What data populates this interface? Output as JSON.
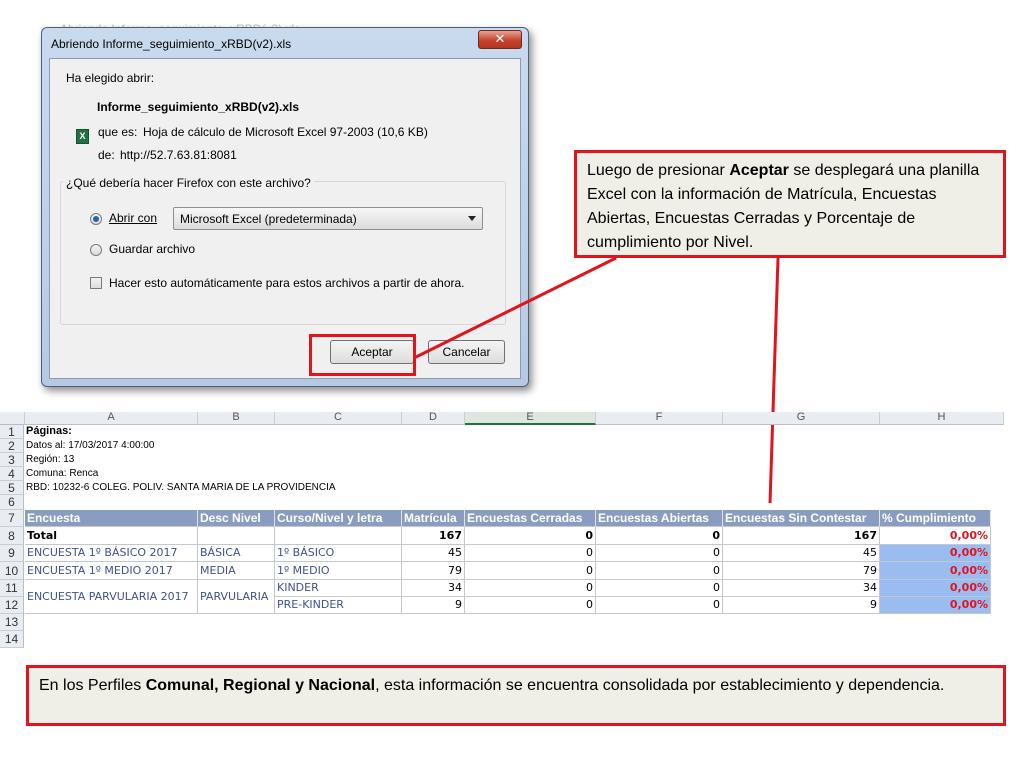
{
  "background_caption": "Abriendo Informe_seguimiento_xRBD(v2).xls",
  "dialog": {
    "title": "Abriendo Informe_seguimiento_xRBD(v2).xls",
    "close_symbol": "✕",
    "prompt": "Ha elegido abrir:",
    "file_icon": "excel-file-icon",
    "file_name": "Informe_seguimiento_xRBD(v2).xls",
    "type_label": "que es:",
    "type_value": "Hoja de cálculo de Microsoft Excel 97-2003 (10,6 KB)",
    "from_label": "de:",
    "from_value": "http://52.7.63.81:8081",
    "question": "¿Qué debería hacer Firefox con este archivo?",
    "open_with_label": "Abrir con",
    "open_with_value": "Microsoft Excel (predeterminada)",
    "save_label": "Guardar archivo",
    "auto_label": "Hacer esto automáticamente para estos archivos a partir de ahora.",
    "accept_button": "Aceptar",
    "cancel_button": "Cancelar"
  },
  "callout_top": {
    "before": "Luego de presionar ",
    "bold": "Aceptar",
    "after": " se desplegará una planilla Excel con la información de Matrícula, Encuestas Abiertas, Encuestas Cerradas y Porcentaje de cumplimiento por Nivel."
  },
  "callout_bottom": {
    "before": "En los Perfiles ",
    "bold": "Comunal, Regional  y Nacional",
    "after": ", esta información se encuentra consolidada  por establecimiento y dependencia."
  },
  "sheet": {
    "columns": [
      "A",
      "B",
      "C",
      "D",
      "E",
      "F",
      "G",
      "H"
    ],
    "row_numbers": [
      "1",
      "2",
      "3",
      "4",
      "5",
      "6",
      "7",
      "8",
      "9",
      "10",
      "11",
      "12",
      "13",
      "14"
    ],
    "meta": [
      "Páginas:",
      "Datos al: 17/03/2017 4:00:00",
      "Región: 13",
      "Comuna: Renca",
      "RBD: 10232-6 COLEG. POLIV. SANTA MARIA DE LA PROVIDENCIA"
    ],
    "headers": [
      "Encuesta",
      "Desc Nivel",
      "Curso/Nivel y letra",
      "Matrícula",
      "Encuestas Cerradas",
      "Encuestas Abiertas",
      "Encuestas Sin Contestar",
      "% Cumplimiento"
    ],
    "total_row": [
      "Total",
      "",
      "",
      "167",
      "0",
      "0",
      "167",
      "0,00%"
    ],
    "rows": [
      [
        "ENCUESTA 1º BÁSICO 2017",
        "BÁSICA",
        "1º BÁSICO",
        "45",
        "0",
        "0",
        "45",
        "0,00%"
      ],
      [
        "ENCUESTA 1º MEDIO 2017",
        "MEDIA",
        "1º MEDIO",
        "79",
        "0",
        "0",
        "79",
        "0,00%"
      ],
      [
        "ENCUESTA PARVULARIA 2017",
        "PARVULARIA",
        "KINDER",
        "34",
        "0",
        "0",
        "34",
        "0,00%"
      ],
      [
        "",
        "",
        "PRE-KINDER",
        "9",
        "0",
        "0",
        "9",
        "0,00%"
      ]
    ]
  },
  "colors": {
    "accent_red": "#e1141e",
    "header_blue": "#8a9cbf",
    "pct_blue": "#9bbcf0",
    "callout_bg": "#efeee7"
  }
}
